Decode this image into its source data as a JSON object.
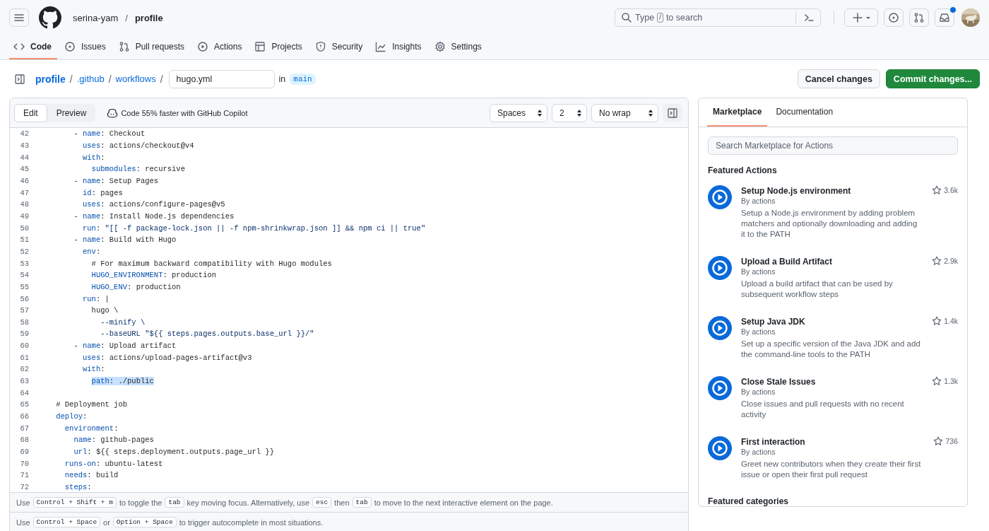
{
  "header": {
    "owner": "serina-yam",
    "separator": "/",
    "repo": "profile",
    "search": {
      "prefix": "Type",
      "key": "/",
      "suffix": "to search"
    },
    "inbox": {
      "unread": true
    }
  },
  "nav": [
    {
      "label": "Code",
      "kind": "code",
      "selected": true
    },
    {
      "label": "Issues",
      "kind": "issue",
      "selected": false
    },
    {
      "label": "Pull requests",
      "kind": "pr",
      "selected": false
    },
    {
      "label": "Actions",
      "kind": "play",
      "selected": false
    },
    {
      "label": "Projects",
      "kind": "table",
      "selected": false
    },
    {
      "label": "Security",
      "kind": "shield",
      "selected": false
    },
    {
      "label": "Insights",
      "kind": "graph",
      "selected": false
    },
    {
      "label": "Settings",
      "kind": "gear",
      "selected": false
    }
  ],
  "breadcrumb": {
    "parts": [
      "profile",
      ".github",
      "workflows"
    ],
    "separator": "/",
    "filename": "hugo.yml",
    "in": "in",
    "branch": "main"
  },
  "actions": {
    "cancel": "Cancel changes",
    "commit": "Commit changes..."
  },
  "editor": {
    "tabs": [
      {
        "label": "Edit",
        "selected": true
      },
      {
        "label": "Preview",
        "selected": false
      }
    ],
    "copilot": "Code 55% faster with GitHub Copilot",
    "selects": [
      "Spaces",
      "2",
      "No wrap"
    ],
    "lines": [
      {
        "n": "42",
        "segments": [
          {
            "t": "        - ",
            "kind": "plain"
          },
          {
            "t": "name",
            "kind": "key"
          },
          {
            "t": ": Checkout",
            "kind": "plain"
          }
        ]
      },
      {
        "n": "43",
        "segments": [
          {
            "t": "          uses",
            "kind": "key"
          },
          {
            "t": ": actions/checkout@v4",
            "kind": "plain"
          }
        ]
      },
      {
        "n": "44",
        "segments": [
          {
            "t": "          with",
            "kind": "key"
          },
          {
            "t": ":",
            "kind": "plain"
          }
        ]
      },
      {
        "n": "45",
        "segments": [
          {
            "t": "            submodules",
            "kind": "key"
          },
          {
            "t": ": recursive",
            "kind": "plain"
          }
        ]
      },
      {
        "n": "46",
        "segments": [
          {
            "t": "        - ",
            "kind": "plain"
          },
          {
            "t": "name",
            "kind": "key"
          },
          {
            "t": ": Setup Pages",
            "kind": "plain"
          }
        ]
      },
      {
        "n": "47",
        "segments": [
          {
            "t": "          id",
            "kind": "key"
          },
          {
            "t": ": pages",
            "kind": "plain"
          }
        ]
      },
      {
        "n": "48",
        "segments": [
          {
            "t": "          uses",
            "kind": "key"
          },
          {
            "t": ": actions/configure-pages@v5",
            "kind": "plain"
          }
        ]
      },
      {
        "n": "49",
        "segments": [
          {
            "t": "        - ",
            "kind": "plain"
          },
          {
            "t": "name",
            "kind": "key"
          },
          {
            "t": ": Install Node.js dependencies",
            "kind": "plain"
          }
        ]
      },
      {
        "n": "50",
        "segments": [
          {
            "t": "          run",
            "kind": "key"
          },
          {
            "t": ": ",
            "kind": "plain"
          },
          {
            "t": "\"[[ -f package-lock.json || -f npm-shrinkwrap.json ]] && npm ci || true\"",
            "kind": "string"
          }
        ]
      },
      {
        "n": "51",
        "segments": [
          {
            "t": "        - ",
            "kind": "plain"
          },
          {
            "t": "name",
            "kind": "key"
          },
          {
            "t": ": Build with Hugo",
            "kind": "plain"
          }
        ]
      },
      {
        "n": "52",
        "segments": [
          {
            "t": "          env",
            "kind": "key"
          },
          {
            "t": ":",
            "kind": "plain"
          }
        ]
      },
      {
        "n": "53",
        "segments": [
          {
            "t": "            # For maximum backward compatibility with Hugo modules",
            "kind": "comment"
          }
        ]
      },
      {
        "n": "54",
        "segments": [
          {
            "t": "            HUGO_ENVIRONMENT",
            "kind": "key"
          },
          {
            "t": ": production",
            "kind": "plain"
          }
        ]
      },
      {
        "n": "55",
        "segments": [
          {
            "t": "            HUGO_ENV",
            "kind": "key"
          },
          {
            "t": ": production",
            "kind": "plain"
          }
        ]
      },
      {
        "n": "56",
        "segments": [
          {
            "t": "          run",
            "kind": "key"
          },
          {
            "t": ": |",
            "kind": "plain"
          }
        ]
      },
      {
        "n": "57",
        "segments": [
          {
            "t": "            hugo \\",
            "kind": "plain"
          }
        ]
      },
      {
        "n": "58",
        "segments": [
          {
            "t": "              --minify \\",
            "kind": "string"
          }
        ]
      },
      {
        "n": "59",
        "segments": [
          {
            "t": "              --baseURL \"${{ steps.pages.outputs.base_url }}/\"",
            "kind": "string"
          }
        ]
      },
      {
        "n": "60",
        "segments": [
          {
            "t": "        - ",
            "kind": "plain"
          },
          {
            "t": "name",
            "kind": "key"
          },
          {
            "t": ": Upload artifact",
            "kind": "plain"
          }
        ]
      },
      {
        "n": "61",
        "segments": [
          {
            "t": "          uses",
            "kind": "key"
          },
          {
            "t": ": actions/upload-pages-artifact@v3",
            "kind": "plain"
          }
        ]
      },
      {
        "n": "62",
        "segments": [
          {
            "t": "          with",
            "kind": "key"
          },
          {
            "t": ":",
            "kind": "plain"
          }
        ]
      },
      {
        "n": "63",
        "selected": true,
        "segments": [
          {
            "t": "path",
            "kind": "key"
          },
          {
            "t": ": ./public",
            "kind": "plain"
          }
        ]
      },
      {
        "n": "64"
      },
      {
        "n": "65",
        "segments": [
          {
            "t": "    # Deployment job",
            "kind": "comment"
          }
        ]
      },
      {
        "n": "66",
        "segments": [
          {
            "t": "    deploy",
            "kind": "key"
          },
          {
            "t": ":",
            "kind": "plain"
          }
        ]
      },
      {
        "n": "67",
        "segments": [
          {
            "t": "      environment",
            "kind": "key"
          },
          {
            "t": ":",
            "kind": "plain"
          }
        ]
      },
      {
        "n": "68",
        "segments": [
          {
            "t": "        name",
            "kind": "key"
          },
          {
            "t": ": github-pages",
            "kind": "plain"
          }
        ]
      },
      {
        "n": "69",
        "segments": [
          {
            "t": "        url",
            "kind": "key"
          },
          {
            "t": ": ${{ steps.deployment.outputs.page_url }}",
            "kind": "plain"
          }
        ]
      },
      {
        "n": "70",
        "segments": [
          {
            "t": "      runs-on",
            "kind": "key"
          },
          {
            "t": ": ubuntu-latest",
            "kind": "plain"
          }
        ]
      },
      {
        "n": "71",
        "segments": [
          {
            "t": "      needs",
            "kind": "key"
          },
          {
            "t": ": build",
            "kind": "plain"
          }
        ]
      },
      {
        "n": "72",
        "segments": [
          {
            "t": "      steps",
            "kind": "key"
          },
          {
            "t": ":",
            "kind": "plain"
          }
        ]
      }
    ],
    "help": [
      [
        {
          "t": "Use",
          "kind": "text"
        },
        {
          "t": "Control + Shift + m",
          "kind": "kbd"
        },
        {
          "t": "to toggle the",
          "kind": "text"
        },
        {
          "t": "tab",
          "kind": "kbd"
        },
        {
          "t": "key moving focus. Alternatively, use",
          "kind": "text"
        },
        {
          "t": "esc",
          "kind": "kbd"
        },
        {
          "t": "then",
          "kind": "text"
        },
        {
          "t": "tab",
          "kind": "kbd"
        },
        {
          "t": "to move to the next interactive element on the page.",
          "kind": "text"
        }
      ],
      [
        {
          "t": "Use",
          "kind": "text"
        },
        {
          "t": "Control + Space",
          "kind": "kbd"
        },
        {
          "t": "or",
          "kind": "text"
        },
        {
          "t": "Option + Space",
          "kind": "kbd"
        },
        {
          "t": "to trigger autocomplete in most situations.",
          "kind": "text"
        }
      ]
    ]
  },
  "sidebar": {
    "tabs": [
      {
        "label": "Marketplace",
        "selected": true
      },
      {
        "label": "Documentation",
        "selected": false
      }
    ],
    "search_placeholder": "Search Marketplace for Actions",
    "featured_heading": "Featured Actions",
    "items": [
      {
        "title": "Setup Node.js environment",
        "by": "By actions",
        "description": "Setup a Node.js environment by adding problem matchers and optionally downloading and adding it to the PATH",
        "stars": "3.6k"
      },
      {
        "title": "Upload a Build Artifact",
        "by": "By actions",
        "description": "Upload a build artifact that can be used by subsequent workflow steps",
        "stars": "2.9k"
      },
      {
        "title": "Setup Java JDK",
        "by": "By actions",
        "description": "Set up a specific version of the Java JDK and add the command-line tools to the PATH",
        "stars": "1.4k"
      },
      {
        "title": "Close Stale Issues",
        "by": "By actions",
        "description": "Close issues and pull requests with no recent activity",
        "stars": "1.3k"
      },
      {
        "title": "First interaction",
        "by": "By actions",
        "description": "Greet new contributors when they create their first issue or open their first pull request",
        "stars": "736"
      }
    ],
    "categories_heading": "Featured categories"
  }
}
